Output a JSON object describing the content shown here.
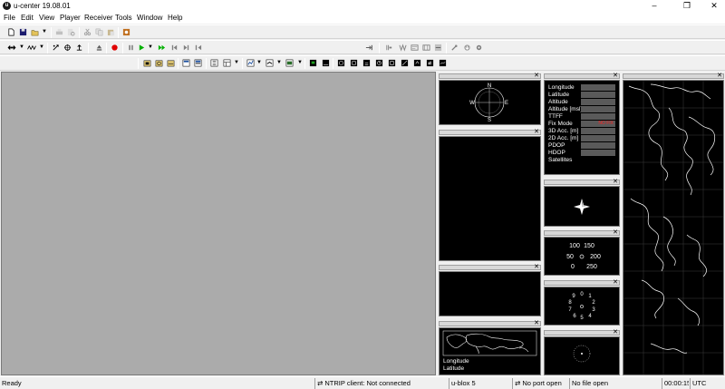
{
  "window": {
    "title": "u-center 19.08.01"
  },
  "menu": [
    "File",
    "Edit",
    "View",
    "Player",
    "Receiver",
    "Tools",
    "Window",
    "Help"
  ],
  "data_view": {
    "rows": [
      "Longitude",
      "Latitude",
      "Altitude",
      "Altitude [msl]",
      "TTFF",
      "Fix Mode",
      "3D Acc. [m]",
      "2D Acc. [m]",
      "PDOP",
      "HDOP",
      "Satellites"
    ],
    "fix_mode_value": "NO FIX"
  },
  "compass": {
    "n": "N",
    "s": "S",
    "e": "E",
    "w": "W"
  },
  "speed_gauge": {
    "labels": [
      "100",
      "150",
      "50",
      "200",
      "0",
      "250"
    ]
  },
  "clock_gauge": {
    "labels": [
      "9",
      "0",
      "1",
      "8",
      "2",
      "7",
      "3",
      "6",
      "5",
      "4"
    ]
  },
  "map_view": {
    "longitude_label": "Longitude",
    "latitude_label": "Latitude"
  },
  "status": {
    "ready": "Ready",
    "ntrip": "NTRIP client: Not connected",
    "receiver": "u-blox 5",
    "port": "No port open",
    "file": "No file open",
    "time": "00:00:15",
    "tz": "UTC"
  },
  "colors": {
    "mdi_bg": "#ababab",
    "record": "#e00000",
    "play": "#00b000",
    "fix_value": "#ff2020"
  }
}
